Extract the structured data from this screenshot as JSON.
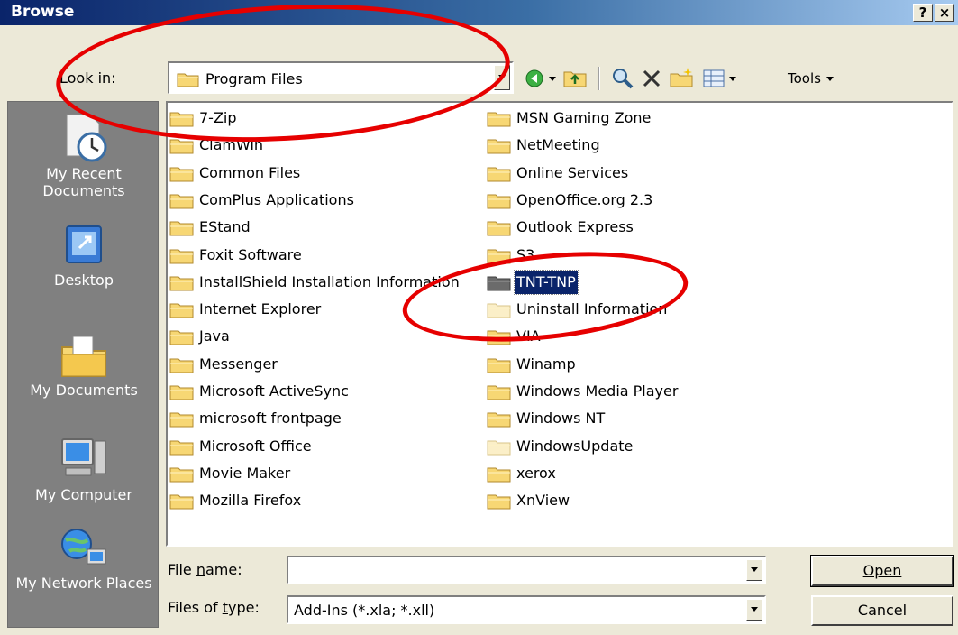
{
  "window": {
    "title": "Browse",
    "help_glyph": "?",
    "close_glyph": "×"
  },
  "toolbar": {
    "lookin_label": "Look in:",
    "lookin_value": "Program Files",
    "tools_label": "Tools",
    "icons": [
      "back-icon",
      "up-folder-icon",
      "search-web-icon",
      "delete-icon",
      "new-folder-icon",
      "views-icon"
    ]
  },
  "places": [
    {
      "label": "My Recent Documents",
      "icon": "recent-documents-icon"
    },
    {
      "label": "Desktop",
      "icon": "desktop-icon"
    },
    {
      "label": "My Documents",
      "icon": "my-documents-icon"
    },
    {
      "label": "My Computer",
      "icon": "my-computer-icon"
    },
    {
      "label": "My Network Places",
      "icon": "network-places-icon"
    }
  ],
  "files": {
    "column1": [
      "7-Zip",
      "ClamWin",
      "Common Files",
      "ComPlus Applications",
      "EStand",
      "Foxit Software",
      "InstallShield Installation Information",
      "Internet Explorer",
      "Java",
      "Messenger",
      "Microsoft ActiveSync",
      "microsoft frontpage",
      "Microsoft Office",
      "Movie Maker",
      "Mozilla Firefox"
    ],
    "column2": [
      "MSN Gaming Zone",
      "NetMeeting",
      "Online Services",
      "OpenOffice.org 2.3",
      "Outlook Express",
      "S3",
      "TNT-TNP",
      "Uninstall Information",
      "VIA",
      "Winamp",
      "Windows Media Player",
      "Windows NT",
      "WindowsUpdate",
      "xerox",
      "XnView"
    ],
    "selected": "TNT-TNP",
    "hidden_folders": [
      "Uninstall Information",
      "WindowsUpdate"
    ]
  },
  "filename": {
    "label": "File name:",
    "value": ""
  },
  "filetype": {
    "label": "Files of type:",
    "value": "Add-Ins (*.xla; *.xll)"
  },
  "buttons": {
    "open": "Open",
    "cancel": "Cancel"
  },
  "colors": {
    "annotation": "#e60000",
    "selection": "#0a246a",
    "title_start": "#0a246a",
    "title_end": "#a6caf0"
  }
}
